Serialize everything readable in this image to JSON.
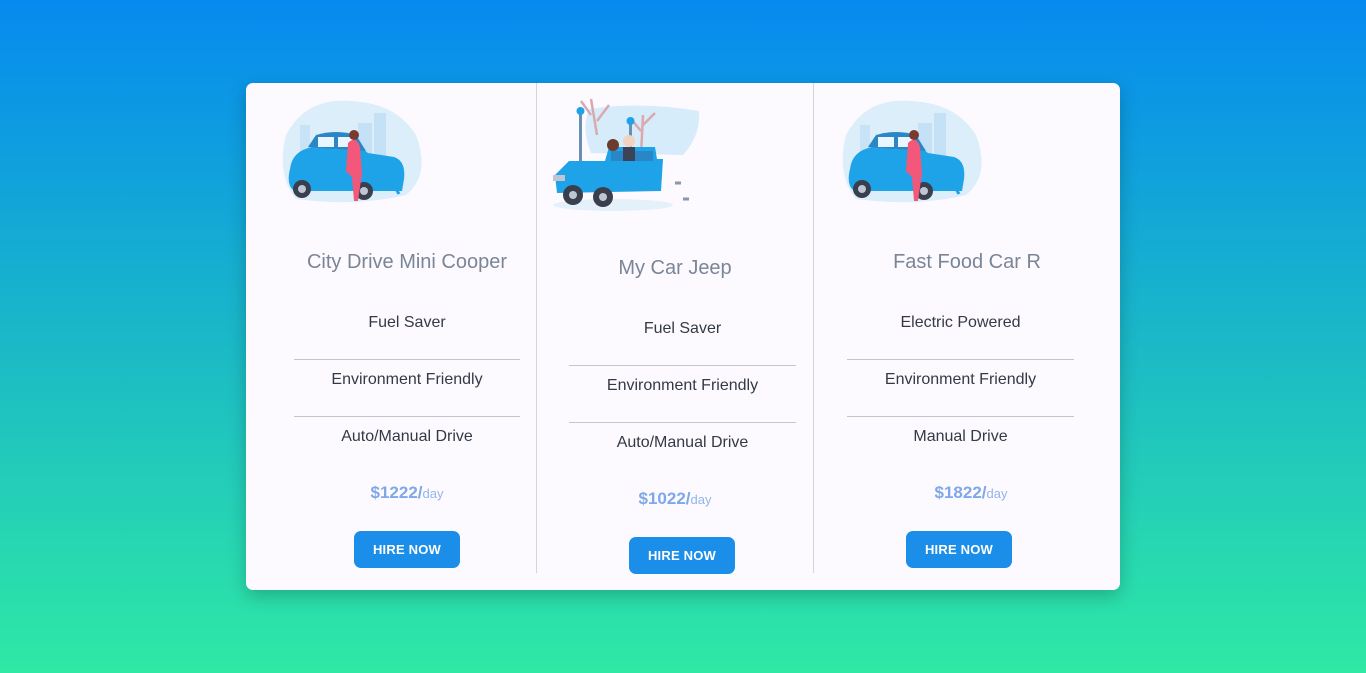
{
  "cards": [
    {
      "title": "City Drive Mini Cooper",
      "image": "mini-cooper-illustration",
      "features": [
        "Fuel Saver",
        "Environment Friendly",
        "Auto/Manual Drive"
      ],
      "price": "$1222/",
      "price_unit": "day",
      "button": "HIRE NOW"
    },
    {
      "title": "My Car Jeep",
      "image": "jeep-illustration",
      "features": [
        "Fuel Saver",
        "Environment Friendly",
        "Auto/Manual Drive"
      ],
      "price": "$1022/",
      "price_unit": "day",
      "button": "HIRE NOW"
    },
    {
      "title": "Fast Food Car R",
      "image": "mini-cooper-illustration",
      "features": [
        "Electric Powered",
        "Environment Friendly",
        "Manual Drive"
      ],
      "price": "$1822/",
      "price_unit": "day",
      "button": "HIRE NOW"
    }
  ],
  "colors": {
    "accent": "#1a8ee8",
    "price": "#7ea8e8",
    "background_top": "#068af0",
    "background_bottom": "#2fe9a4"
  }
}
